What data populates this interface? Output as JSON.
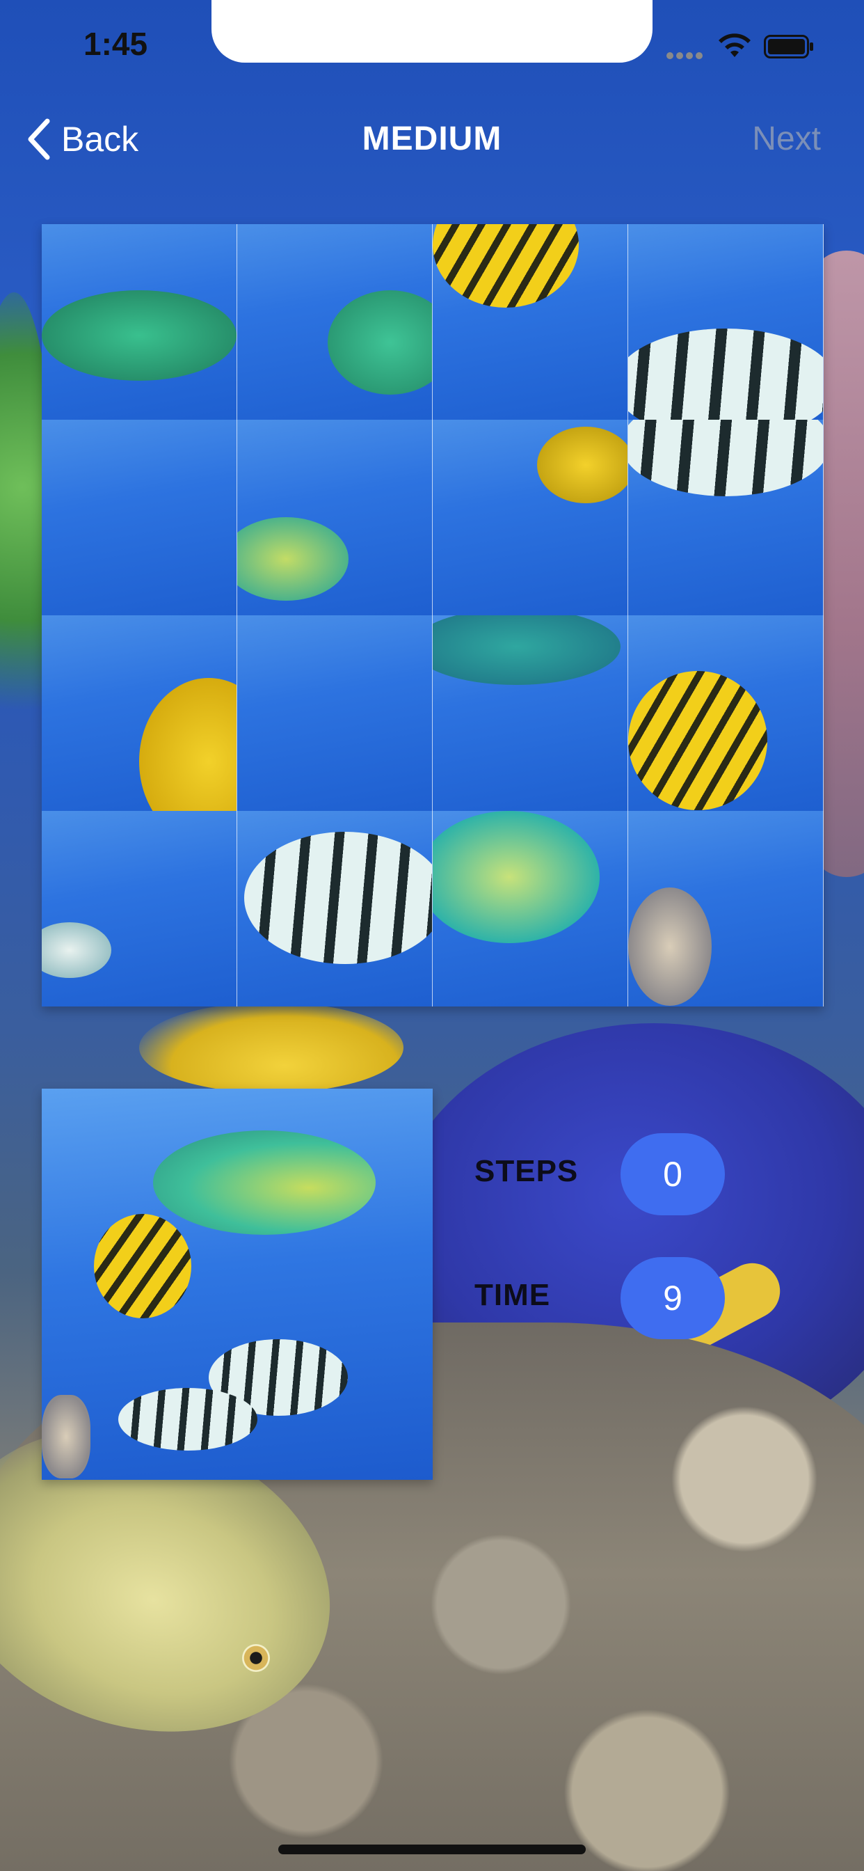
{
  "status_bar": {
    "time": "1:45"
  },
  "nav": {
    "back_label": "Back",
    "title": "MEDIUM",
    "next_label": "Next"
  },
  "stats": {
    "steps_label": "STEPS",
    "steps_value": "0",
    "time_label": "TIME",
    "time_value": "9"
  },
  "board": {
    "rows": 4,
    "columns": 4
  },
  "icons": {
    "back": "chevron-left-icon",
    "wifi": "wifi-icon",
    "battery": "battery-icon",
    "signal": "cellular-signal-icon"
  },
  "colors": {
    "accent_pill": "#3f6df0",
    "water": "#2d73e0",
    "fish_yellow": "#f0cf1e",
    "fish_teal": "#3fbf9a"
  }
}
